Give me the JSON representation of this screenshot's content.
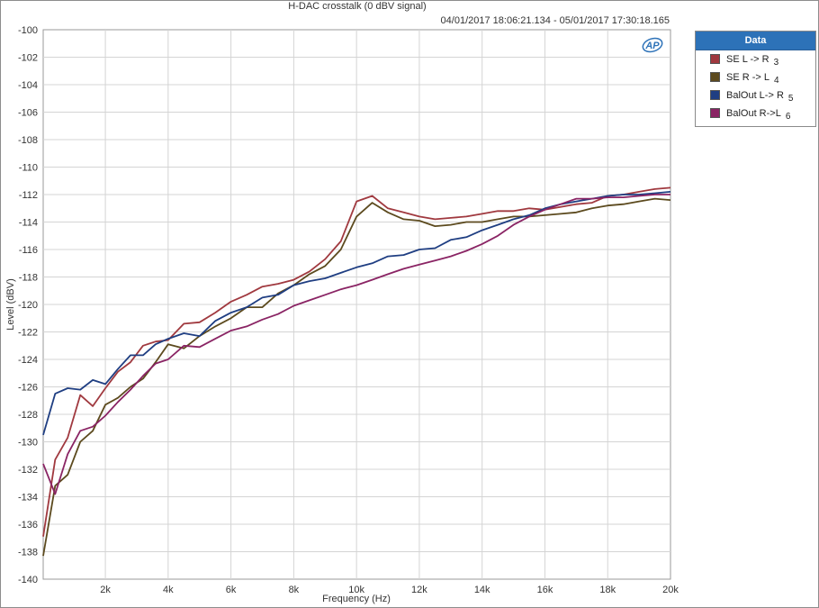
{
  "title": "H-DAC crosstalk (0 dBV signal)",
  "subtitle": "04/01/2017 18:06:21.134 - 05/01/2017 17:30:18.165",
  "logo_text": "AP",
  "legend": {
    "header": "Data",
    "items": [
      {
        "label": "SE L -> R",
        "sub": "3",
        "color": "#a0393f"
      },
      {
        "label": "SE R -> L",
        "sub": "4",
        "color": "#5c4a1e"
      },
      {
        "label": "BalOut L-> R",
        "sub": "5",
        "color": "#1f3e82"
      },
      {
        "label": "BalOut R->L",
        "sub": "6",
        "color": "#8a2464"
      }
    ]
  },
  "chart_data": {
    "type": "line",
    "title": "H-DAC crosstalk (0 dBV signal)",
    "xlabel": "Frequency (Hz)",
    "ylabel": "Level (dBV)",
    "xlim": [
      20,
      20000
    ],
    "ylim": [
      -140,
      -100
    ],
    "grid": true,
    "legend_position": "top-right outside",
    "x_ticks": [
      2000,
      4000,
      6000,
      8000,
      10000,
      12000,
      14000,
      16000,
      18000,
      20000
    ],
    "x_tick_labels": [
      "2k",
      "4k",
      "6k",
      "8k",
      "10k",
      "12k",
      "14k",
      "16k",
      "18k",
      "20k"
    ],
    "y_ticks": [
      -100,
      -102,
      -104,
      -106,
      -108,
      -110,
      -112,
      -114,
      -116,
      -118,
      -120,
      -122,
      -124,
      -126,
      -128,
      -130,
      -132,
      -134,
      -136,
      -138,
      -140
    ],
    "y_tick_labels": [
      "-100",
      "-102",
      "-104",
      "-106",
      "-108",
      "-110",
      "-112",
      "-114",
      "-116",
      "-118",
      "-120",
      "-122",
      "-124",
      "-126",
      "-128",
      "-130",
      "-132",
      "-134",
      "-136",
      "-138",
      "-140"
    ],
    "series": [
      {
        "name": "SE L -> R",
        "color": "#a0393f",
        "points": [
          [
            20,
            -136.9
          ],
          [
            400,
            -131.3
          ],
          [
            800,
            -129.7
          ],
          [
            1200,
            -126.6
          ],
          [
            1600,
            -127.4
          ],
          [
            2000,
            -126.1
          ],
          [
            2400,
            -124.9
          ],
          [
            2800,
            -124.2
          ],
          [
            3200,
            -123.0
          ],
          [
            3600,
            -122.7
          ],
          [
            4000,
            -122.6
          ],
          [
            4500,
            -121.4
          ],
          [
            5000,
            -121.3
          ],
          [
            5500,
            -120.6
          ],
          [
            6000,
            -119.8
          ],
          [
            6500,
            -119.3
          ],
          [
            7000,
            -118.7
          ],
          [
            7500,
            -118.5
          ],
          [
            8000,
            -118.2
          ],
          [
            8500,
            -117.6
          ],
          [
            9000,
            -116.7
          ],
          [
            9500,
            -115.4
          ],
          [
            10000,
            -112.5
          ],
          [
            10500,
            -112.1
          ],
          [
            11000,
            -113.0
          ],
          [
            11500,
            -113.3
          ],
          [
            12000,
            -113.6
          ],
          [
            12500,
            -113.8
          ],
          [
            13000,
            -113.7
          ],
          [
            13500,
            -113.6
          ],
          [
            14000,
            -113.4
          ],
          [
            14500,
            -113.2
          ],
          [
            15000,
            -113.2
          ],
          [
            15500,
            -113.0
          ],
          [
            16000,
            -113.1
          ],
          [
            16500,
            -112.9
          ],
          [
            17000,
            -112.7
          ],
          [
            17500,
            -112.6
          ],
          [
            18000,
            -112.1
          ],
          [
            18500,
            -112.0
          ],
          [
            19000,
            -111.8
          ],
          [
            19500,
            -111.6
          ],
          [
            20000,
            -111.5
          ]
        ]
      },
      {
        "name": "SE R -> L",
        "color": "#5c4a1e",
        "points": [
          [
            20,
            -138.3
          ],
          [
            400,
            -133.2
          ],
          [
            800,
            -132.4
          ],
          [
            1200,
            -130.0
          ],
          [
            1600,
            -129.2
          ],
          [
            2000,
            -127.3
          ],
          [
            2400,
            -126.8
          ],
          [
            2800,
            -126.0
          ],
          [
            3200,
            -125.4
          ],
          [
            3600,
            -124.2
          ],
          [
            4000,
            -122.9
          ],
          [
            4500,
            -123.2
          ],
          [
            5000,
            -122.3
          ],
          [
            5500,
            -121.6
          ],
          [
            6000,
            -121.0
          ],
          [
            6500,
            -120.2
          ],
          [
            7000,
            -120.2
          ],
          [
            7500,
            -119.2
          ],
          [
            8000,
            -118.6
          ],
          [
            8500,
            -117.8
          ],
          [
            9000,
            -117.2
          ],
          [
            9500,
            -116.0
          ],
          [
            10000,
            -113.6
          ],
          [
            10500,
            -112.6
          ],
          [
            11000,
            -113.3
          ],
          [
            11500,
            -113.8
          ],
          [
            12000,
            -113.9
          ],
          [
            12500,
            -114.3
          ],
          [
            13000,
            -114.2
          ],
          [
            13500,
            -114.0
          ],
          [
            14000,
            -114.0
          ],
          [
            14500,
            -113.8
          ],
          [
            15000,
            -113.6
          ],
          [
            15500,
            -113.6
          ],
          [
            16000,
            -113.5
          ],
          [
            16500,
            -113.4
          ],
          [
            17000,
            -113.3
          ],
          [
            17500,
            -113.0
          ],
          [
            18000,
            -112.8
          ],
          [
            18500,
            -112.7
          ],
          [
            19000,
            -112.5
          ],
          [
            19500,
            -112.3
          ],
          [
            20000,
            -112.4
          ]
        ]
      },
      {
        "name": "BalOut L-> R",
        "color": "#1f3e82",
        "points": [
          [
            20,
            -129.5
          ],
          [
            400,
            -126.5
          ],
          [
            800,
            -126.1
          ],
          [
            1200,
            -126.2
          ],
          [
            1600,
            -125.5
          ],
          [
            2000,
            -125.8
          ],
          [
            2400,
            -124.7
          ],
          [
            2800,
            -123.7
          ],
          [
            3200,
            -123.7
          ],
          [
            3600,
            -122.9
          ],
          [
            4000,
            -122.5
          ],
          [
            4500,
            -122.1
          ],
          [
            5000,
            -122.3
          ],
          [
            5500,
            -121.2
          ],
          [
            6000,
            -120.6
          ],
          [
            6500,
            -120.2
          ],
          [
            7000,
            -119.5
          ],
          [
            7500,
            -119.3
          ],
          [
            8000,
            -118.6
          ],
          [
            8500,
            -118.3
          ],
          [
            9000,
            -118.1
          ],
          [
            9500,
            -117.7
          ],
          [
            10000,
            -117.3
          ],
          [
            10500,
            -117.0
          ],
          [
            11000,
            -116.5
          ],
          [
            11500,
            -116.4
          ],
          [
            12000,
            -116.0
          ],
          [
            12500,
            -115.9
          ],
          [
            13000,
            -115.3
          ],
          [
            13500,
            -115.1
          ],
          [
            14000,
            -114.6
          ],
          [
            14500,
            -114.2
          ],
          [
            15000,
            -113.8
          ],
          [
            15500,
            -113.5
          ],
          [
            16000,
            -113.0
          ],
          [
            16500,
            -112.7
          ],
          [
            17000,
            -112.5
          ],
          [
            17500,
            -112.3
          ],
          [
            18000,
            -112.1
          ],
          [
            18500,
            -112.0
          ],
          [
            19000,
            -112.0
          ],
          [
            19500,
            -111.9
          ],
          [
            20000,
            -111.8
          ]
        ]
      },
      {
        "name": "BalOut R->L",
        "color": "#8a2464",
        "points": [
          [
            20,
            -131.6
          ],
          [
            400,
            -133.8
          ],
          [
            800,
            -130.9
          ],
          [
            1200,
            -129.2
          ],
          [
            1600,
            -128.9
          ],
          [
            2000,
            -128.1
          ],
          [
            2400,
            -127.1
          ],
          [
            2800,
            -126.2
          ],
          [
            3200,
            -125.2
          ],
          [
            3600,
            -124.3
          ],
          [
            4000,
            -124.0
          ],
          [
            4500,
            -123.0
          ],
          [
            5000,
            -123.1
          ],
          [
            5500,
            -122.5
          ],
          [
            6000,
            -121.9
          ],
          [
            6500,
            -121.6
          ],
          [
            7000,
            -121.1
          ],
          [
            7500,
            -120.7
          ],
          [
            8000,
            -120.1
          ],
          [
            8500,
            -119.7
          ],
          [
            9000,
            -119.3
          ],
          [
            9500,
            -118.9
          ],
          [
            10000,
            -118.6
          ],
          [
            10500,
            -118.2
          ],
          [
            11000,
            -117.8
          ],
          [
            11500,
            -117.4
          ],
          [
            12000,
            -117.1
          ],
          [
            12500,
            -116.8
          ],
          [
            13000,
            -116.5
          ],
          [
            13500,
            -116.1
          ],
          [
            14000,
            -115.6
          ],
          [
            14500,
            -115.0
          ],
          [
            15000,
            -114.2
          ],
          [
            15500,
            -113.6
          ],
          [
            16000,
            -113.1
          ],
          [
            16500,
            -112.7
          ],
          [
            17000,
            -112.3
          ],
          [
            17500,
            -112.3
          ],
          [
            18000,
            -112.2
          ],
          [
            18500,
            -112.2
          ],
          [
            19000,
            -112.1
          ],
          [
            19500,
            -112.0
          ],
          [
            20000,
            -112.0
          ]
        ]
      }
    ]
  }
}
